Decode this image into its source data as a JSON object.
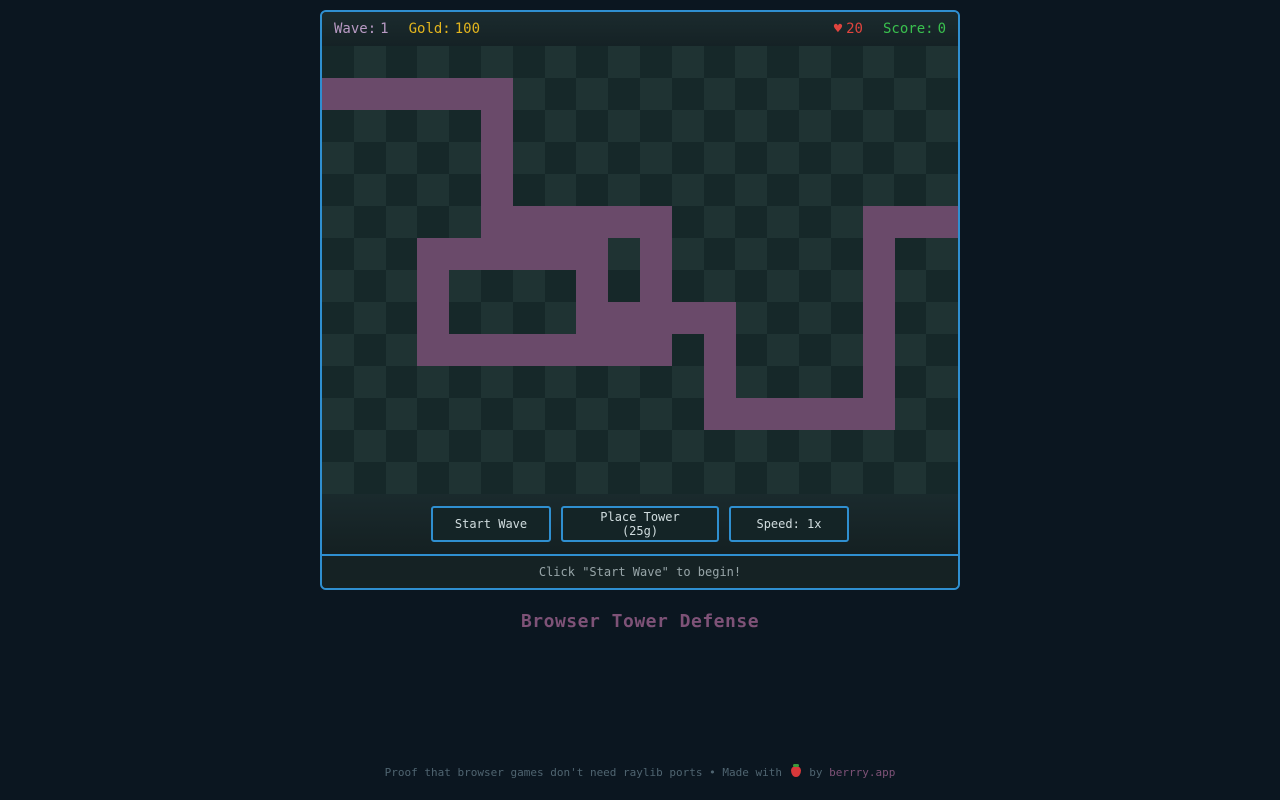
{
  "hud": {
    "wave_label": "Wave:",
    "wave_value": "1",
    "gold_label": "Gold:",
    "gold_value": "100",
    "lives_icon": "♥",
    "lives_value": "20",
    "score_label": "Score:",
    "score_value": "0"
  },
  "board": {
    "cols": 20,
    "rows": 14,
    "path_color": "#6a4a6a",
    "path_cells": [
      [
        0,
        1
      ],
      [
        1,
        1
      ],
      [
        2,
        1
      ],
      [
        3,
        1
      ],
      [
        4,
        1
      ],
      [
        5,
        1
      ],
      [
        5,
        2
      ],
      [
        5,
        3
      ],
      [
        5,
        4
      ],
      [
        5,
        5
      ],
      [
        6,
        5
      ],
      [
        7,
        5
      ],
      [
        8,
        5
      ],
      [
        9,
        5
      ],
      [
        10,
        5
      ],
      [
        3,
        6
      ],
      [
        4,
        6
      ],
      [
        5,
        6
      ],
      [
        6,
        6
      ],
      [
        7,
        6
      ],
      [
        8,
        6
      ],
      [
        10,
        6
      ],
      [
        3,
        7
      ],
      [
        8,
        7
      ],
      [
        10,
        7
      ],
      [
        3,
        8
      ],
      [
        8,
        8
      ],
      [
        9,
        8
      ],
      [
        10,
        8
      ],
      [
        11,
        8
      ],
      [
        12,
        8
      ],
      [
        3,
        9
      ],
      [
        4,
        9
      ],
      [
        5,
        9
      ],
      [
        6,
        9
      ],
      [
        7,
        9
      ],
      [
        8,
        9
      ],
      [
        9,
        9
      ],
      [
        10,
        9
      ],
      [
        12,
        9
      ],
      [
        12,
        10
      ],
      [
        12,
        11
      ],
      [
        13,
        11
      ],
      [
        14,
        11
      ],
      [
        15,
        11
      ],
      [
        16,
        11
      ],
      [
        17,
        11
      ],
      [
        17,
        10
      ],
      [
        17,
        9
      ],
      [
        17,
        8
      ],
      [
        17,
        7
      ],
      [
        17,
        6
      ],
      [
        17,
        5
      ],
      [
        18,
        5
      ],
      [
        19,
        5
      ]
    ]
  },
  "controls": {
    "start_wave": "Start Wave",
    "place_tower": "Place Tower (25g)",
    "speed": "Speed: 1x"
  },
  "status": "Click \"Start Wave\" to begin!",
  "title": "Browser Tower Defense",
  "footer": {
    "text_before": "Proof that browser games don't need raylib ports • Made with",
    "text_by": "by",
    "link": "berrry.app",
    "icon": "strawberry-icon"
  },
  "colors": {
    "accent": "#2f8fd0",
    "gold": "#e3b51d",
    "lives": "#e0443e",
    "score": "#39c04e",
    "wave": "#b89ac4"
  }
}
